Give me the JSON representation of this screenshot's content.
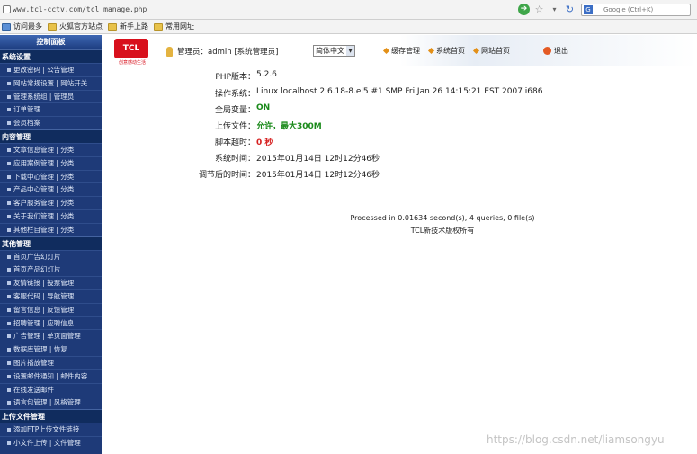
{
  "browser": {
    "url": "www.tcl-cctv.com/tcl_manage.php",
    "search_placeholder": "Google (Ctrl+K)",
    "search_engine_label": "G",
    "bookmarks": [
      {
        "label": "访问最多"
      },
      {
        "label": "火狐官方站点"
      },
      {
        "label": "新手上路"
      },
      {
        "label": "常用网址"
      }
    ]
  },
  "sidebar": {
    "title": "控制面板",
    "groups": [
      {
        "title": "系统设置",
        "items": [
          "更改密码 | 公告管理",
          "网站常规设置 | 网站开关",
          "管理系统组 | 管理员",
          "订单管理",
          "会员档案"
        ]
      },
      {
        "title": "内容管理",
        "items": [
          "文章信息管理 | 分类",
          "应用案例管理 | 分类",
          "下载中心管理 | 分类",
          "产品中心管理 | 分类",
          "客户服务管理 | 分类",
          "关于我们管理 | 分类",
          "其他栏目管理 | 分类"
        ]
      },
      {
        "title": "其他管理",
        "items": [
          "首页广告幻灯片",
          "首页产品幻灯片",
          "友情链接 | 投票管理",
          "客服代码 | 导航管理",
          "留言信息 | 反馈管理",
          "招聘管理 | 应聘信息",
          "广告管理 | 单页面管理",
          "数据库管理 | 恢复",
          "图片播放管理",
          "设置邮件通知 | 邮件内容",
          "在线发送邮件",
          "语言包管理 | 风格管理"
        ]
      },
      {
        "title": "上传文件管理",
        "items": [
          "添加FTP上传文件链接",
          "小文件上传 | 文件管理"
        ]
      }
    ]
  },
  "header": {
    "logo_text": "TCL",
    "logo_sub": "创意感动生活",
    "admin_label": "管理员：admin [系统管理员]",
    "language": "简体中文",
    "nav": [
      "缓存管理",
      "系统首页",
      "网站首页"
    ],
    "logout": "退出"
  },
  "info": [
    {
      "label": "PHP版本：",
      "value": "5.2.6",
      "style": "normal"
    },
    {
      "label": "操作系统：",
      "value": "Linux localhost 2.6.18-8.el5 #1 SMP Fri Jan 26 14:15:21 EST 2007 i686",
      "style": "normal"
    },
    {
      "label": "全局变量：",
      "value": "ON",
      "style": "green"
    },
    {
      "label": "上传文件：",
      "value": "允许，最大300M",
      "style": "green"
    },
    {
      "label": "脚本超时：",
      "value": "0 秒",
      "style": "red"
    },
    {
      "label": "系统时间：",
      "value": "2015年01月14日 12时12分46秒",
      "style": "normal"
    },
    {
      "label": "调节后的时间：",
      "value": "2015年01月14日 12时12分46秒",
      "style": "normal"
    }
  ],
  "footer": {
    "processed": "Processed in 0.01634 second(s), 4 queries, 0 file(s)",
    "copyright": "TCL新技术版权所有"
  },
  "watermark": "https://blog.csdn.net/liamsongyu"
}
